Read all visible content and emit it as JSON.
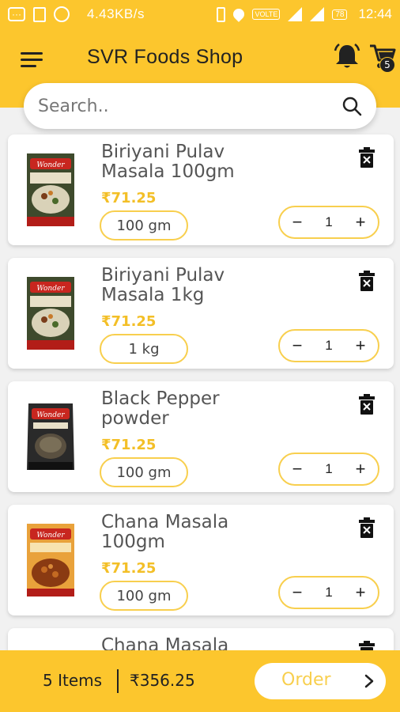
{
  "status_bar": {
    "speed": "4.43KB/s",
    "volte": "VOLTE",
    "battery": "78",
    "time": "12:44"
  },
  "header": {
    "title": "SVR Foods Shop",
    "cart_count": "5"
  },
  "search": {
    "placeholder": "Search.."
  },
  "cart_items": [
    {
      "name": "Biriyani Pulav Masala 100gm",
      "price": "₹71.25",
      "variant": "100 gm",
      "qty": "1",
      "thumb": "masala-box"
    },
    {
      "name": "Biriyani Pulav Masala 1kg",
      "price": "₹71.25",
      "variant": "1 kg",
      "qty": "1",
      "thumb": "masala-box"
    },
    {
      "name": "Black Pepper powder",
      "price": "₹71.25",
      "variant": "100 gm",
      "qty": "1",
      "thumb": "pepper-pack"
    },
    {
      "name": "Chana Masala 100gm",
      "price": "₹71.25",
      "variant": "100 gm",
      "qty": "1",
      "thumb": "chana-box"
    },
    {
      "name": "Chana Masala",
      "price": "",
      "variant": "",
      "qty": "",
      "thumb": ""
    }
  ],
  "footer": {
    "items_label": "5 Items",
    "total": "₹356.25",
    "order_label": "Order"
  },
  "colors": {
    "primary_yellow": "#fcc62d",
    "price_yellow": "#f3bf27"
  }
}
